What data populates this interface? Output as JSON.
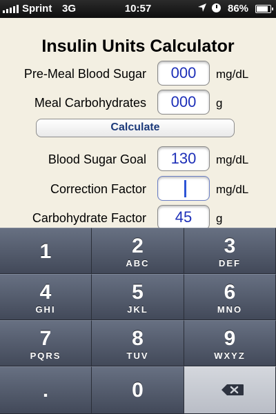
{
  "status_bar": {
    "carrier": "Sprint",
    "network": "3G",
    "time": "10:57",
    "battery": "86%"
  },
  "app": {
    "title": "Insulin Units Calculator"
  },
  "fields": [
    {
      "label": "Pre-Meal Blood Sugar",
      "value": "000",
      "unit": "mg/dL"
    },
    {
      "label": "Meal Carbohydrates",
      "value": "000",
      "unit": "g"
    },
    {
      "label": "Blood Sugar Goal",
      "value": "130",
      "unit": "mg/dL"
    },
    {
      "label": "Correction Factor",
      "value": "",
      "unit": "mg/dL"
    },
    {
      "label": "Carbohydrate Factor",
      "value": "45",
      "unit": "g"
    }
  ],
  "calculate_label": "Calculate",
  "keypad": {
    "keys": [
      {
        "digit": "1",
        "letters": ""
      },
      {
        "digit": "2",
        "letters": "ABC"
      },
      {
        "digit": "3",
        "letters": "DEF"
      },
      {
        "digit": "4",
        "letters": "GHI"
      },
      {
        "digit": "5",
        "letters": "JKL"
      },
      {
        "digit": "6",
        "letters": "MNO"
      },
      {
        "digit": "7",
        "letters": "PQRS"
      },
      {
        "digit": "8",
        "letters": "TUV"
      },
      {
        "digit": "9",
        "letters": "WXYZ"
      },
      {
        "digit": ".",
        "letters": ""
      },
      {
        "digit": "0",
        "letters": ""
      }
    ]
  },
  "colors": {
    "background": "#f3efe2",
    "field_text": "#1d2fb8",
    "button_text": "#1c3a7a",
    "keypad": "#424959"
  },
  "icons": [
    "signal-icon",
    "location-icon",
    "alarm-clock-icon",
    "battery-icon",
    "delete-backspace-icon"
  ]
}
